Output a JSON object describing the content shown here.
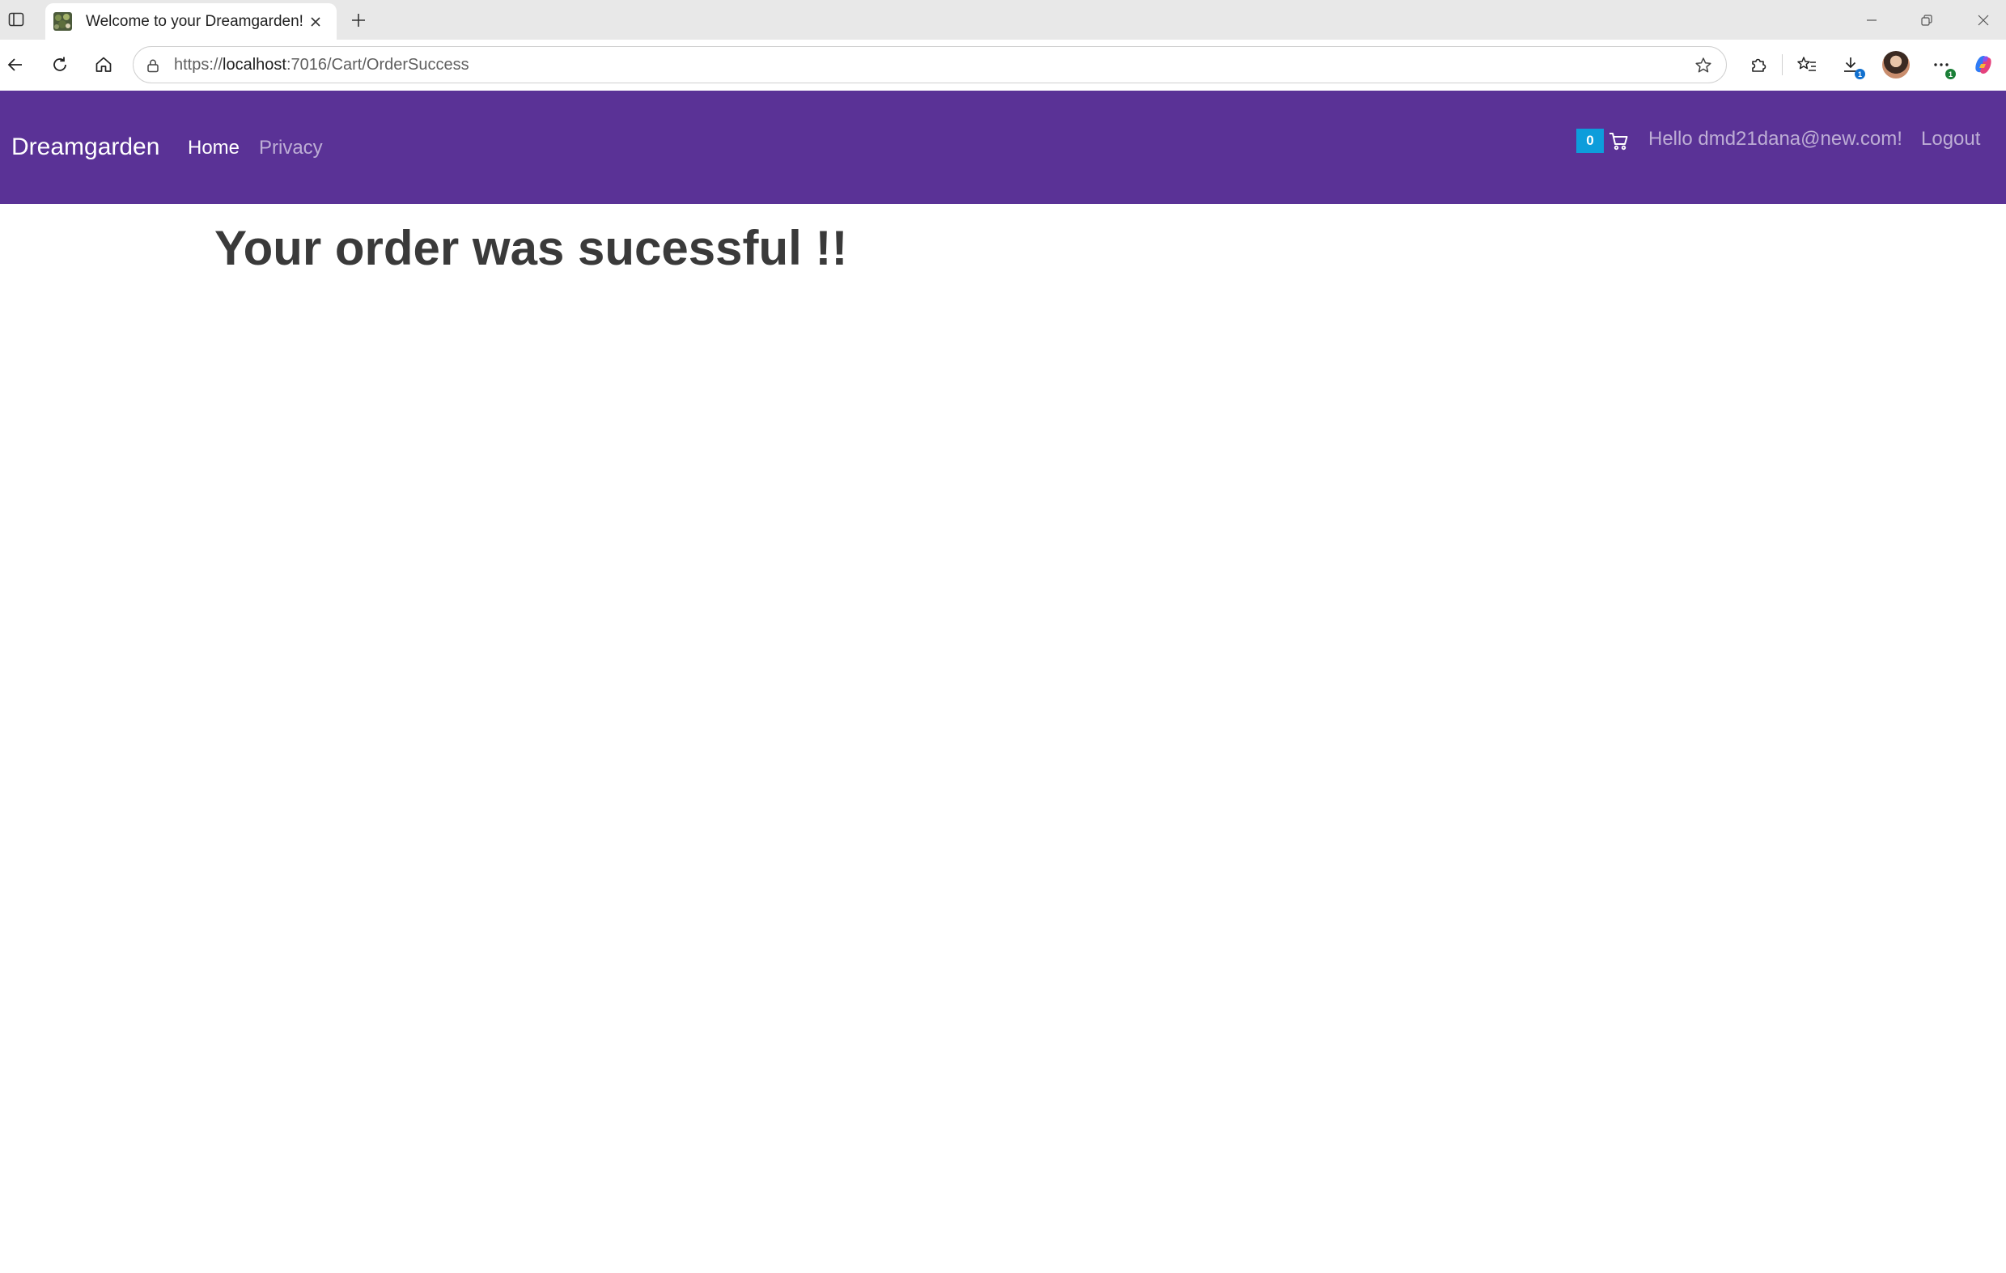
{
  "browser": {
    "tab": {
      "title": "Welcome to your Dreamgarden!"
    },
    "address": {
      "scheme": "https://",
      "host": "localhost",
      "path": ":7016/Cart/OrderSuccess"
    },
    "downloads_badge": "1",
    "menu_badge": "1"
  },
  "site": {
    "brand": "Dreamgarden",
    "nav": {
      "home": "Home",
      "privacy": "Privacy"
    },
    "cart_count": "0",
    "greeting": "Hello dmd21dana@new.com!",
    "logout": "Logout",
    "accent_color": "#5a3296",
    "badge_color": "#0d9ddb"
  },
  "main": {
    "heading": "Your order was sucessful !!"
  }
}
